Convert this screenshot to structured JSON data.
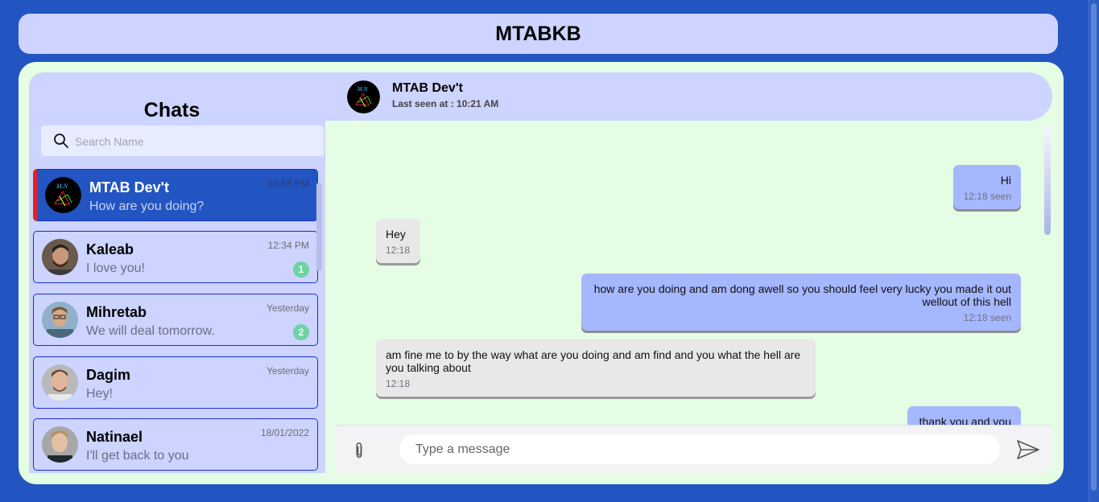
{
  "app": {
    "title": "MTABKB"
  },
  "sidebar": {
    "title": "Chats",
    "search_placeholder": "Search Name",
    "chats": [
      {
        "name": "MTAB Dev't",
        "last_message": "How are you doing?",
        "time": "10:56 PM",
        "unread": null,
        "active": true,
        "avatar": "logo-avatar"
      },
      {
        "name": "Kaleab",
        "last_message": "I love you!",
        "time": "12:34 PM",
        "unread": "1",
        "active": false,
        "avatar": "user-avatar"
      },
      {
        "name": "Mihretab",
        "last_message": "We will deal tomorrow.",
        "time": "Yesterday",
        "unread": "2",
        "active": false,
        "avatar": "user-avatar"
      },
      {
        "name": "Dagim",
        "last_message": "Hey!",
        "time": "Yesterday",
        "unread": null,
        "active": false,
        "avatar": "user-avatar"
      },
      {
        "name": "Natinael",
        "last_message": "I'll get back to you",
        "time": "18/01/2022",
        "unread": null,
        "active": false,
        "avatar": "user-avatar"
      }
    ]
  },
  "conversation": {
    "contact_name": "MTAB Dev't",
    "last_seen": "Last seen at : 10:21 AM",
    "messages": [
      {
        "direction": "out",
        "text": "Hi",
        "meta": "12:18 seen"
      },
      {
        "direction": "in",
        "text": "Hey",
        "meta": "12:18"
      },
      {
        "direction": "out",
        "text": "how are you doing and am dong awell so you should feel very lucky you made it out wellout of this hell",
        "meta": "12:18 seen"
      },
      {
        "direction": "in",
        "text": "am fine me to by the way what are you doing and am find and you what the hell are you talking about",
        "meta": "12:18"
      },
      {
        "direction": "out",
        "text": "thank you and you",
        "meta": ""
      }
    ]
  },
  "composer": {
    "placeholder": "Type a message",
    "attach_icon": "paperclip-icon",
    "send_icon": "send-icon"
  },
  "colors": {
    "page_bg": "#2255c1",
    "panel_bg": "#ccd4ff",
    "chat_bg": "#e4fde4",
    "outgoing_bubble": "#a5b7ff",
    "incoming_bubble": "#e8e8e8",
    "active_accent": "#e0202a",
    "badge": "#6ed3a3"
  }
}
